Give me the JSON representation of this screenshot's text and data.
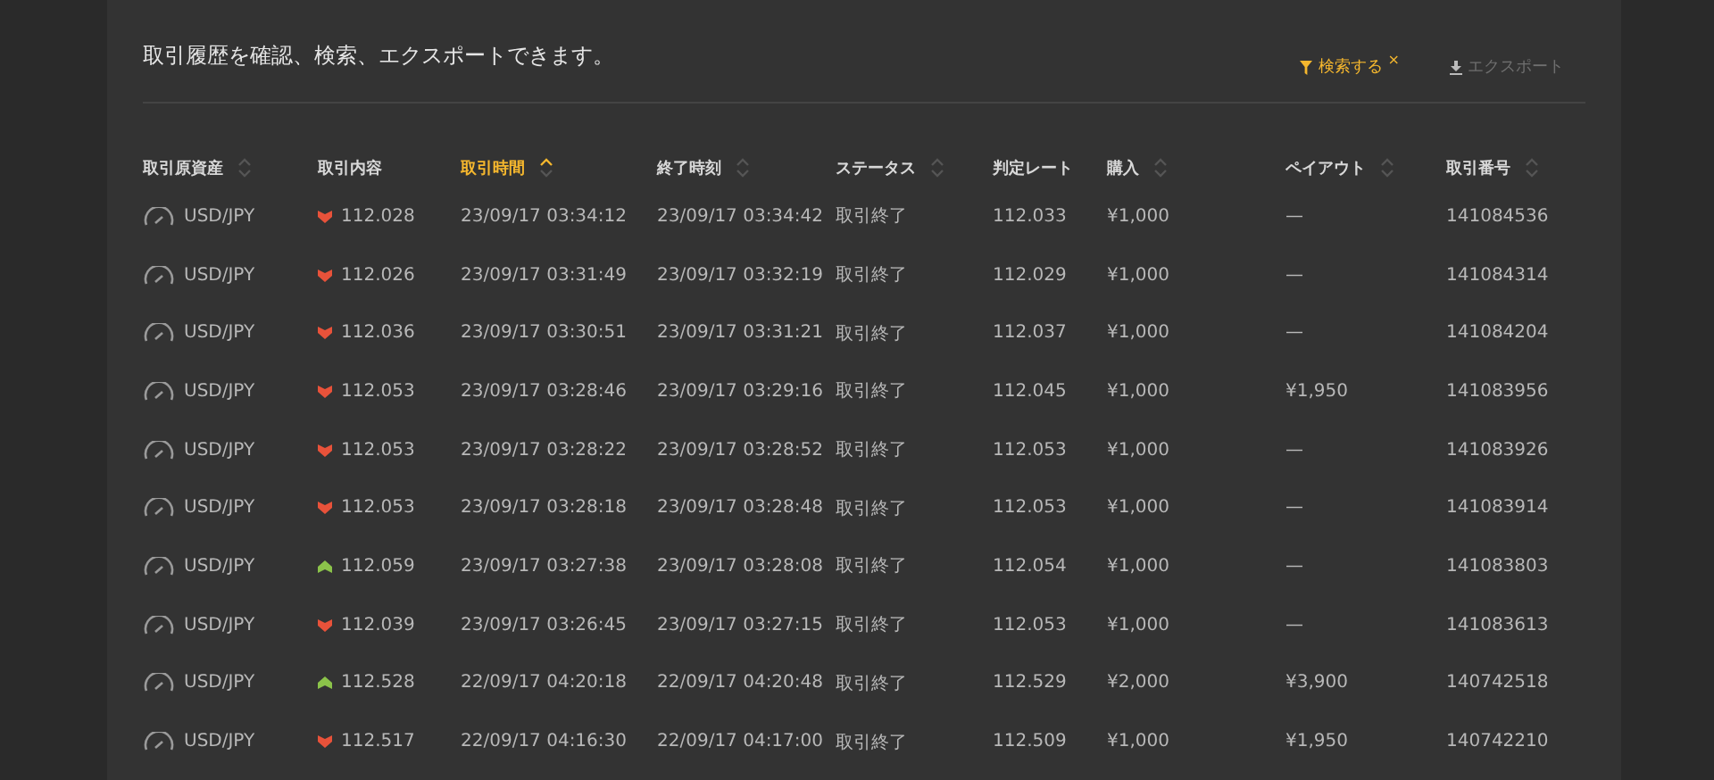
{
  "description": "取引履歴を確認、検索、エクスポートできます。",
  "actions": [
    {
      "kind": "filter",
      "label": "検索する",
      "close": "×",
      "disabled": false
    },
    {
      "kind": "export",
      "label": "エクスポート",
      "disabled": true
    }
  ],
  "table": {
    "columns": [
      {
        "label": "取引原資産",
        "sortable": true,
        "selected": false
      },
      {
        "label": "取引内容",
        "sortable": false,
        "selected": false
      },
      {
        "label": "取引時間",
        "sortable": true,
        "selected": true
      },
      {
        "label": "終了時刻",
        "sortable": true,
        "selected": false
      },
      {
        "label": "ステータス",
        "sortable": true,
        "selected": false
      },
      {
        "label": "判定レート",
        "sortable": false,
        "selected": false
      },
      {
        "label": "購入",
        "sortable": true,
        "selected": false
      },
      {
        "label": "ペイアウト",
        "sortable": true,
        "selected": false
      },
      {
        "label": "取引番号",
        "sortable": true,
        "selected": false
      }
    ],
    "rows": [
      {
        "asset": "USD/JPY",
        "kind": "down",
        "rate": "112.028",
        "start": "23/09/17 03:34:12",
        "end": "23/09/17 03:34:42",
        "status": "取引終了",
        "result_rate": "112.033",
        "purchase": "¥1,000",
        "payout": "—",
        "id": "141084536"
      },
      {
        "asset": "USD/JPY",
        "kind": "down",
        "rate": "112.026",
        "start": "23/09/17 03:31:49",
        "end": "23/09/17 03:32:19",
        "status": "取引終了",
        "result_rate": "112.029",
        "purchase": "¥1,000",
        "payout": "—",
        "id": "141084314"
      },
      {
        "asset": "USD/JPY",
        "kind": "down",
        "rate": "112.036",
        "start": "23/09/17 03:30:51",
        "end": "23/09/17 03:31:21",
        "status": "取引終了",
        "result_rate": "112.037",
        "purchase": "¥1,000",
        "payout": "—",
        "id": "141084204"
      },
      {
        "asset": "USD/JPY",
        "kind": "down",
        "rate": "112.053",
        "start": "23/09/17 03:28:46",
        "end": "23/09/17 03:29:16",
        "status": "取引終了",
        "result_rate": "112.045",
        "purchase": "¥1,000",
        "payout": "¥1,950",
        "id": "141083956"
      },
      {
        "asset": "USD/JPY",
        "kind": "down",
        "rate": "112.053",
        "start": "23/09/17 03:28:22",
        "end": "23/09/17 03:28:52",
        "status": "取引終了",
        "result_rate": "112.053",
        "purchase": "¥1,000",
        "payout": "—",
        "id": "141083926"
      },
      {
        "asset": "USD/JPY",
        "kind": "down",
        "rate": "112.053",
        "start": "23/09/17 03:28:18",
        "end": "23/09/17 03:28:48",
        "status": "取引終了",
        "result_rate": "112.053",
        "purchase": "¥1,000",
        "payout": "—",
        "id": "141083914"
      },
      {
        "asset": "USD/JPY",
        "kind": "up",
        "rate": "112.059",
        "start": "23/09/17 03:27:38",
        "end": "23/09/17 03:28:08",
        "status": "取引終了",
        "result_rate": "112.054",
        "purchase": "¥1,000",
        "payout": "—",
        "id": "141083803"
      },
      {
        "asset": "USD/JPY",
        "kind": "down",
        "rate": "112.039",
        "start": "23/09/17 03:26:45",
        "end": "23/09/17 03:27:15",
        "status": "取引終了",
        "result_rate": "112.053",
        "purchase": "¥1,000",
        "payout": "—",
        "id": "141083613"
      },
      {
        "asset": "USD/JPY",
        "kind": "up",
        "rate": "112.528",
        "start": "22/09/17 04:20:18",
        "end": "22/09/17 04:20:48",
        "status": "取引終了",
        "result_rate": "112.529",
        "purchase": "¥2,000",
        "payout": "¥3,900",
        "id": "140742518"
      },
      {
        "asset": "USD/JPY",
        "kind": "down",
        "rate": "112.517",
        "start": "22/09/17 04:16:30",
        "end": "22/09/17 04:17:00",
        "status": "取引終了",
        "result_rate": "112.509",
        "purchase": "¥1,000",
        "payout": "¥1,950",
        "id": "140742210"
      }
    ]
  }
}
